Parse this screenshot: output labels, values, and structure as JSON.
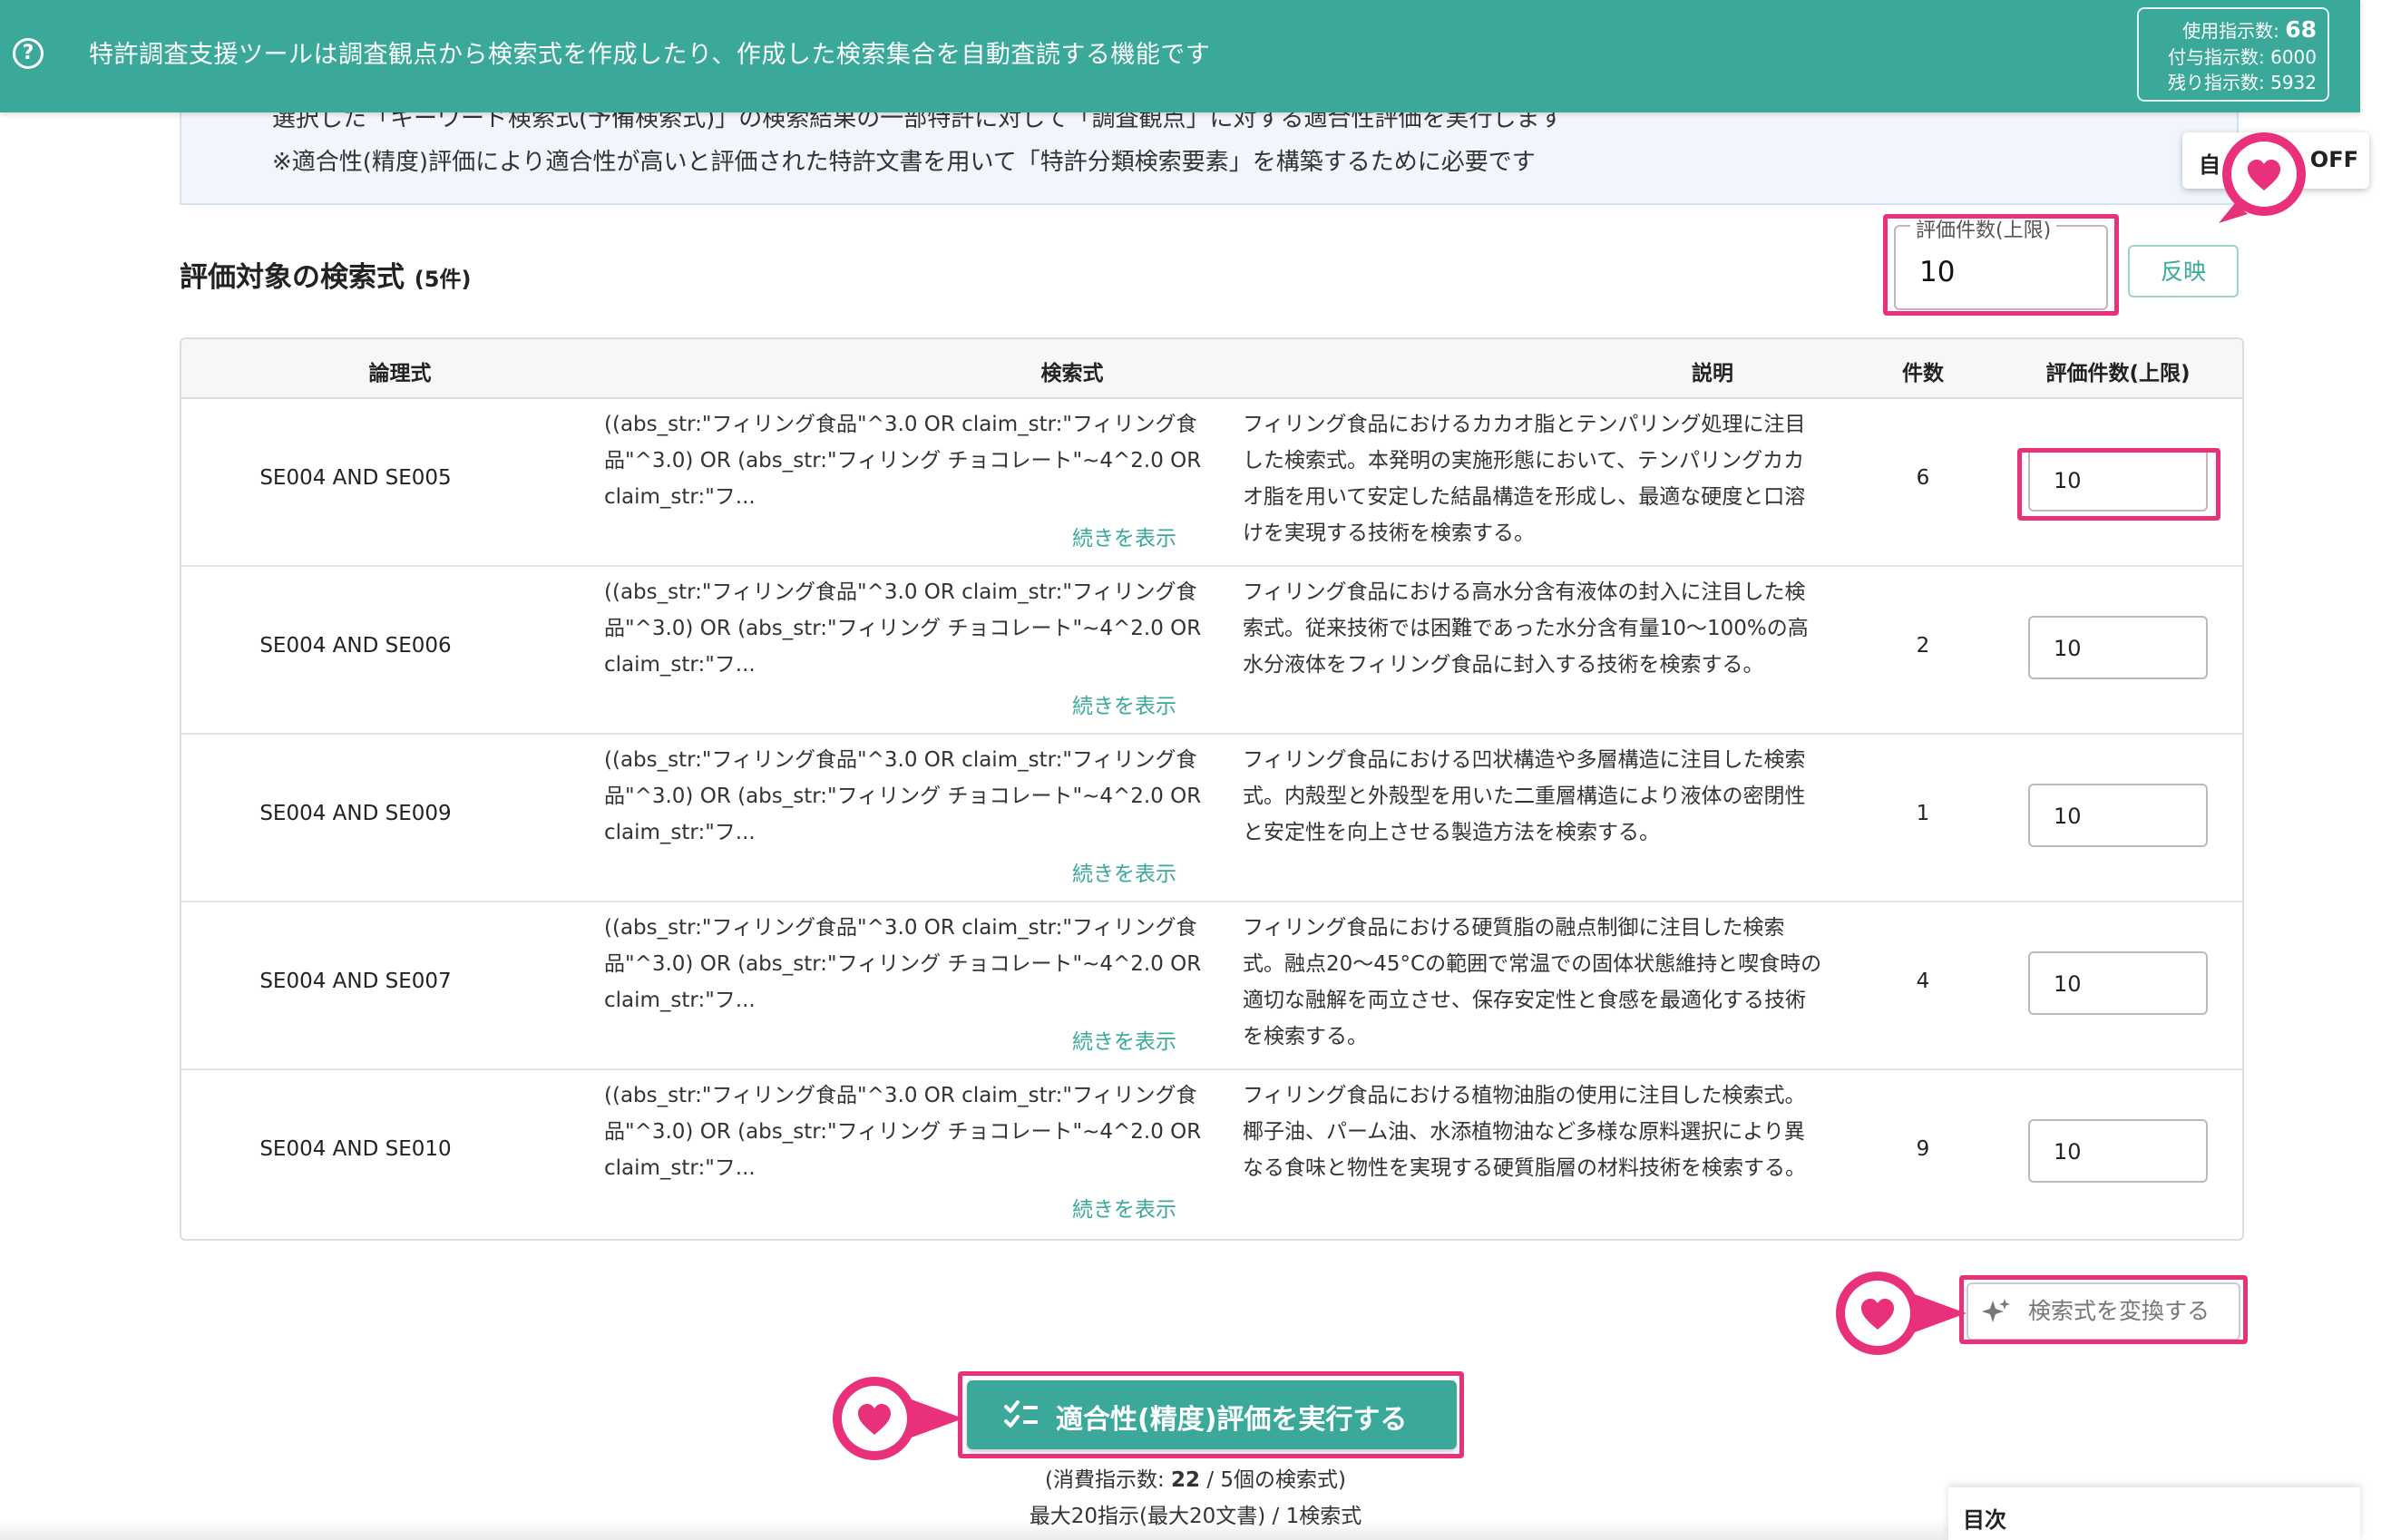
{
  "banner": {
    "text": "特許調査支援ツールは調査観点から検索式を作成したり、作成した検索集合を自動査読する機能です",
    "usage_label": "使用指示数:",
    "usage_value": "68",
    "granted_label": "付与指示数:",
    "granted_value": "6000",
    "remaining_label": "残り指示数:",
    "remaining_value": "5932"
  },
  "info": {
    "line1": "選択した「キーワード検索式(予備検索式)」の検索結果の一部特許に対して「調査観点」に対する適合性評価を実行します",
    "line2": "※適合性(精度)評価により適合性が高いと評価された特許文書を用いて「特許分類検索要素」を構築するために必要です"
  },
  "auto_toggle": {
    "left": "自",
    "right": "OFF"
  },
  "section": {
    "title": "評価対象の検索式",
    "count": "(5件)",
    "limit_label": "評価件数(上限)",
    "limit_value": "10",
    "apply_label": "反映"
  },
  "table": {
    "headers": [
      "論理式",
      "検索式",
      "説明",
      "件数",
      "評価件数(上限)"
    ],
    "more_label": "続きを表示",
    "rows": [
      {
        "logic": "SE004 AND SE005",
        "query": "((abs_str:\"フィリング食品\"^3.0 OR claim_str:\"フィリング食品\"^3.0) OR (abs_str:\"フィリング チョコレート\"~4^2.0 OR claim_str:\"フ...",
        "desc": "フィリング食品におけるカカオ脂とテンパリング処理に注目した検索式。本発明の実施形態において、テンパリングカカオ脂を用いて安定した結晶構造を形成し、最適な硬度と口溶けを実現する技術を検索する。",
        "count": "6",
        "limit": "10"
      },
      {
        "logic": "SE004 AND SE006",
        "query": "((abs_str:\"フィリング食品\"^3.0 OR claim_str:\"フィリング食品\"^3.0) OR (abs_str:\"フィリング チョコレート\"~4^2.0 OR claim_str:\"フ...",
        "desc": "フィリング食品における高水分含有液体の封入に注目した検索式。従来技術では困難であった水分含有量10〜100%の高水分液体をフィリング食品に封入する技術を検索する。",
        "count": "2",
        "limit": "10"
      },
      {
        "logic": "SE004 AND SE009",
        "query": "((abs_str:\"フィリング食品\"^3.0 OR claim_str:\"フィリング食品\"^3.0) OR (abs_str:\"フィリング チョコレート\"~4^2.0 OR claim_str:\"フ...",
        "desc": "フィリング食品における凹状構造や多層構造に注目した検索式。内殻型と外殻型を用いた二重層構造により液体の密閉性と安定性を向上させる製造方法を検索する。",
        "count": "1",
        "limit": "10"
      },
      {
        "logic": "SE004 AND SE007",
        "query": "((abs_str:\"フィリング食品\"^3.0 OR claim_str:\"フィリング食品\"^3.0) OR (abs_str:\"フィリング チョコレート\"~4^2.0 OR claim_str:\"フ...",
        "desc": "フィリング食品における硬質脂の融点制御に注目した検索式。融点20〜45°Cの範囲で常温での固体状態維持と喫食時の適切な融解を両立させ、保存安定性と食感を最適化する技術を検索する。",
        "count": "4",
        "limit": "10"
      },
      {
        "logic": "SE004 AND SE010",
        "query": "((abs_str:\"フィリング食品\"^3.0 OR claim_str:\"フィリング食品\"^3.0) OR (abs_str:\"フィリング チョコレート\"~4^2.0 OR claim_str:\"フ...",
        "desc": "フィリング食品における植物油脂の使用に注目した検索式。椰子油、パーム油、水添植物油など多様な原料選択により異なる食味と物性を実現する硬質脂層の材料技術を検索する。",
        "count": "9",
        "limit": "10"
      }
    ]
  },
  "convert_button": {
    "label": "検索式を変換する"
  },
  "execute_button": {
    "label": "適合性(精度)評価を実行する"
  },
  "consume": {
    "line1_prefix": "(消費指示数: ",
    "line1_value": "22",
    "line1_suffix": " / 5個の検索式)",
    "line2": "最大20指示(最大20文書) / 1検索式"
  },
  "toc": {
    "label": "目次"
  },
  "colors": {
    "accent": "#3aa99a",
    "highlight": "#e8317a",
    "info_bg": "#f1f6fd"
  }
}
